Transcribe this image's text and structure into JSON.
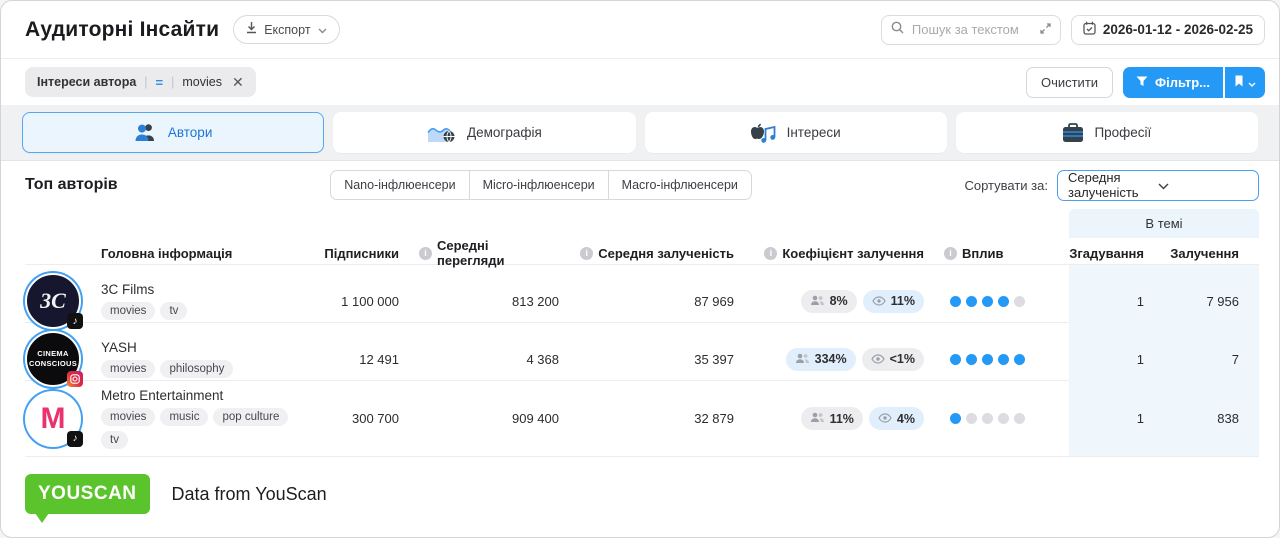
{
  "header": {
    "title": "Аудиторні Інсайти",
    "export_label": "Експорт",
    "search_placeholder": "Пошук за текстом",
    "date_range": "2026-01-12 - 2026-02-25"
  },
  "filter_bar": {
    "chip_field": "Інтереси автора",
    "chip_operator": "=",
    "chip_value": "movies",
    "clear_label": "Очистити",
    "filter_label": "Фільтр..."
  },
  "tabs": [
    {
      "label": "Автори"
    },
    {
      "label": "Демографія"
    },
    {
      "label": "Інтереси"
    },
    {
      "label": "Професії"
    }
  ],
  "section": {
    "title": "Топ авторів",
    "segments": [
      "Nano-інфлюенсери",
      "Micro-інфлюенсери",
      "Macro-інфлюенсери"
    ],
    "sort_label": "Сортувати за:",
    "sort_value": "Середня залученість"
  },
  "table": {
    "headers": {
      "main_info": "Головна інформація",
      "subscribers": "Підписники",
      "avg_views": "Середні перегляди",
      "avg_engagement": "Середня залученість",
      "engagement_rate": "Коефіцієнт залучення",
      "influence": "Вплив",
      "in_topic": "В темі",
      "mentions": "Згадування",
      "engagement": "Залучення"
    },
    "rows": [
      {
        "name": "3C Films",
        "platform": "tiktok",
        "avatar_line1": "3C",
        "avatar_line2": "",
        "tags": [
          "movies",
          "tv"
        ],
        "subscribers": "1 100 000",
        "avg_views": "813 200",
        "avg_engagement": "87 969",
        "er_subscribers": {
          "value": "8%",
          "style": "gray"
        },
        "er_views": {
          "value": "11%",
          "style": "blue"
        },
        "influence": 4,
        "mentions": "1",
        "engagement": "7 956"
      },
      {
        "name": "YASH",
        "platform": "instagram",
        "avatar_line1": "CINEMA",
        "avatar_line2": "CONSCIOUS",
        "tags": [
          "movies",
          "philosophy"
        ],
        "subscribers": "12 491",
        "avg_views": "4 368",
        "avg_engagement": "35 397",
        "er_subscribers": {
          "value": "334%",
          "style": "blue"
        },
        "er_views": {
          "value": "<1%",
          "style": "gray"
        },
        "influence": 5,
        "mentions": "1",
        "engagement": "7"
      },
      {
        "name": "Metro Entertainment",
        "platform": "tiktok",
        "avatar_line1": "M",
        "avatar_line2": "",
        "tags": [
          "movies",
          "music",
          "pop culture",
          "tv"
        ],
        "subscribers": "300 700",
        "avg_views": "909 400",
        "avg_engagement": "32 879",
        "er_subscribers": {
          "value": "11%",
          "style": "gray"
        },
        "er_views": {
          "value": "4%",
          "style": "blue"
        },
        "influence": 1,
        "mentions": "1",
        "engagement": "838"
      }
    ]
  },
  "footer": {
    "logo": "YOUSCAN",
    "text": "Data from YouScan"
  },
  "colors": {
    "accent_blue": "#2499f5",
    "panel_blue": "#eff6fc",
    "youscan_green": "#5bc42c"
  }
}
